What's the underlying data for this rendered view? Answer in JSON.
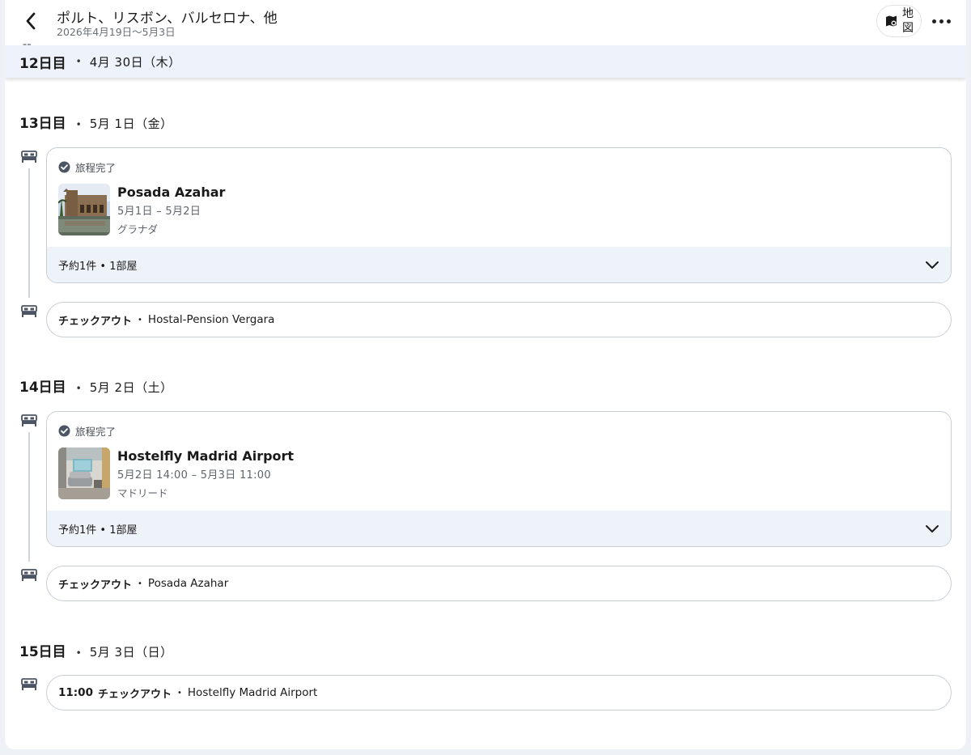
{
  "header": {
    "trip_title": "ポルト、リスボン、バルセロナ、他",
    "trip_dates": "2026年4月19日〜5月3日",
    "map_label": "地図"
  },
  "sticky_day": {
    "day": "12日目",
    "separator": "•",
    "date": "4月 30日（木）"
  },
  "days": [
    {
      "day": "13日目",
      "separator": "•",
      "date": "5月 1日（金）",
      "stay": {
        "status": "旅程完了",
        "name": "Posada Azahar",
        "dates": "5月1日 – 5月2日",
        "city": "グラナダ",
        "reservation": "予約1件 • 1部屋"
      },
      "checkout": {
        "time": "",
        "kind": "チェックアウト",
        "separator": "•",
        "place": "Hostal-Pension Vergara"
      }
    },
    {
      "day": "14日目",
      "separator": "•",
      "date": "5月 2日（土）",
      "stay": {
        "status": "旅程完了",
        "name": "Hostelfly Madrid Airport",
        "dates": "5月2日 14:00 – 5月3日 11:00",
        "city": "マドリード",
        "reservation": "予約1件 • 1部屋"
      },
      "checkout": {
        "time": "",
        "kind": "チェックアウト",
        "separator": "•",
        "place": "Posada Azahar"
      }
    },
    {
      "day": "15日目",
      "separator": "•",
      "date": "5月 3日（日）",
      "checkout": {
        "time": "11:00",
        "kind": "チェックアウト",
        "separator": "•",
        "place": "Hostelfly Madrid Airport"
      }
    }
  ],
  "icons": {
    "back": "chevron-left-icon",
    "map": "map-icon",
    "more": "more-horizontal-icon",
    "bed": "bed-icon",
    "check": "check-circle-icon",
    "expand": "chevron-down-icon"
  },
  "colors": {
    "accent_bar": "#eef2f9",
    "border": "#c9ced6",
    "muted_text": "#5f646b"
  }
}
